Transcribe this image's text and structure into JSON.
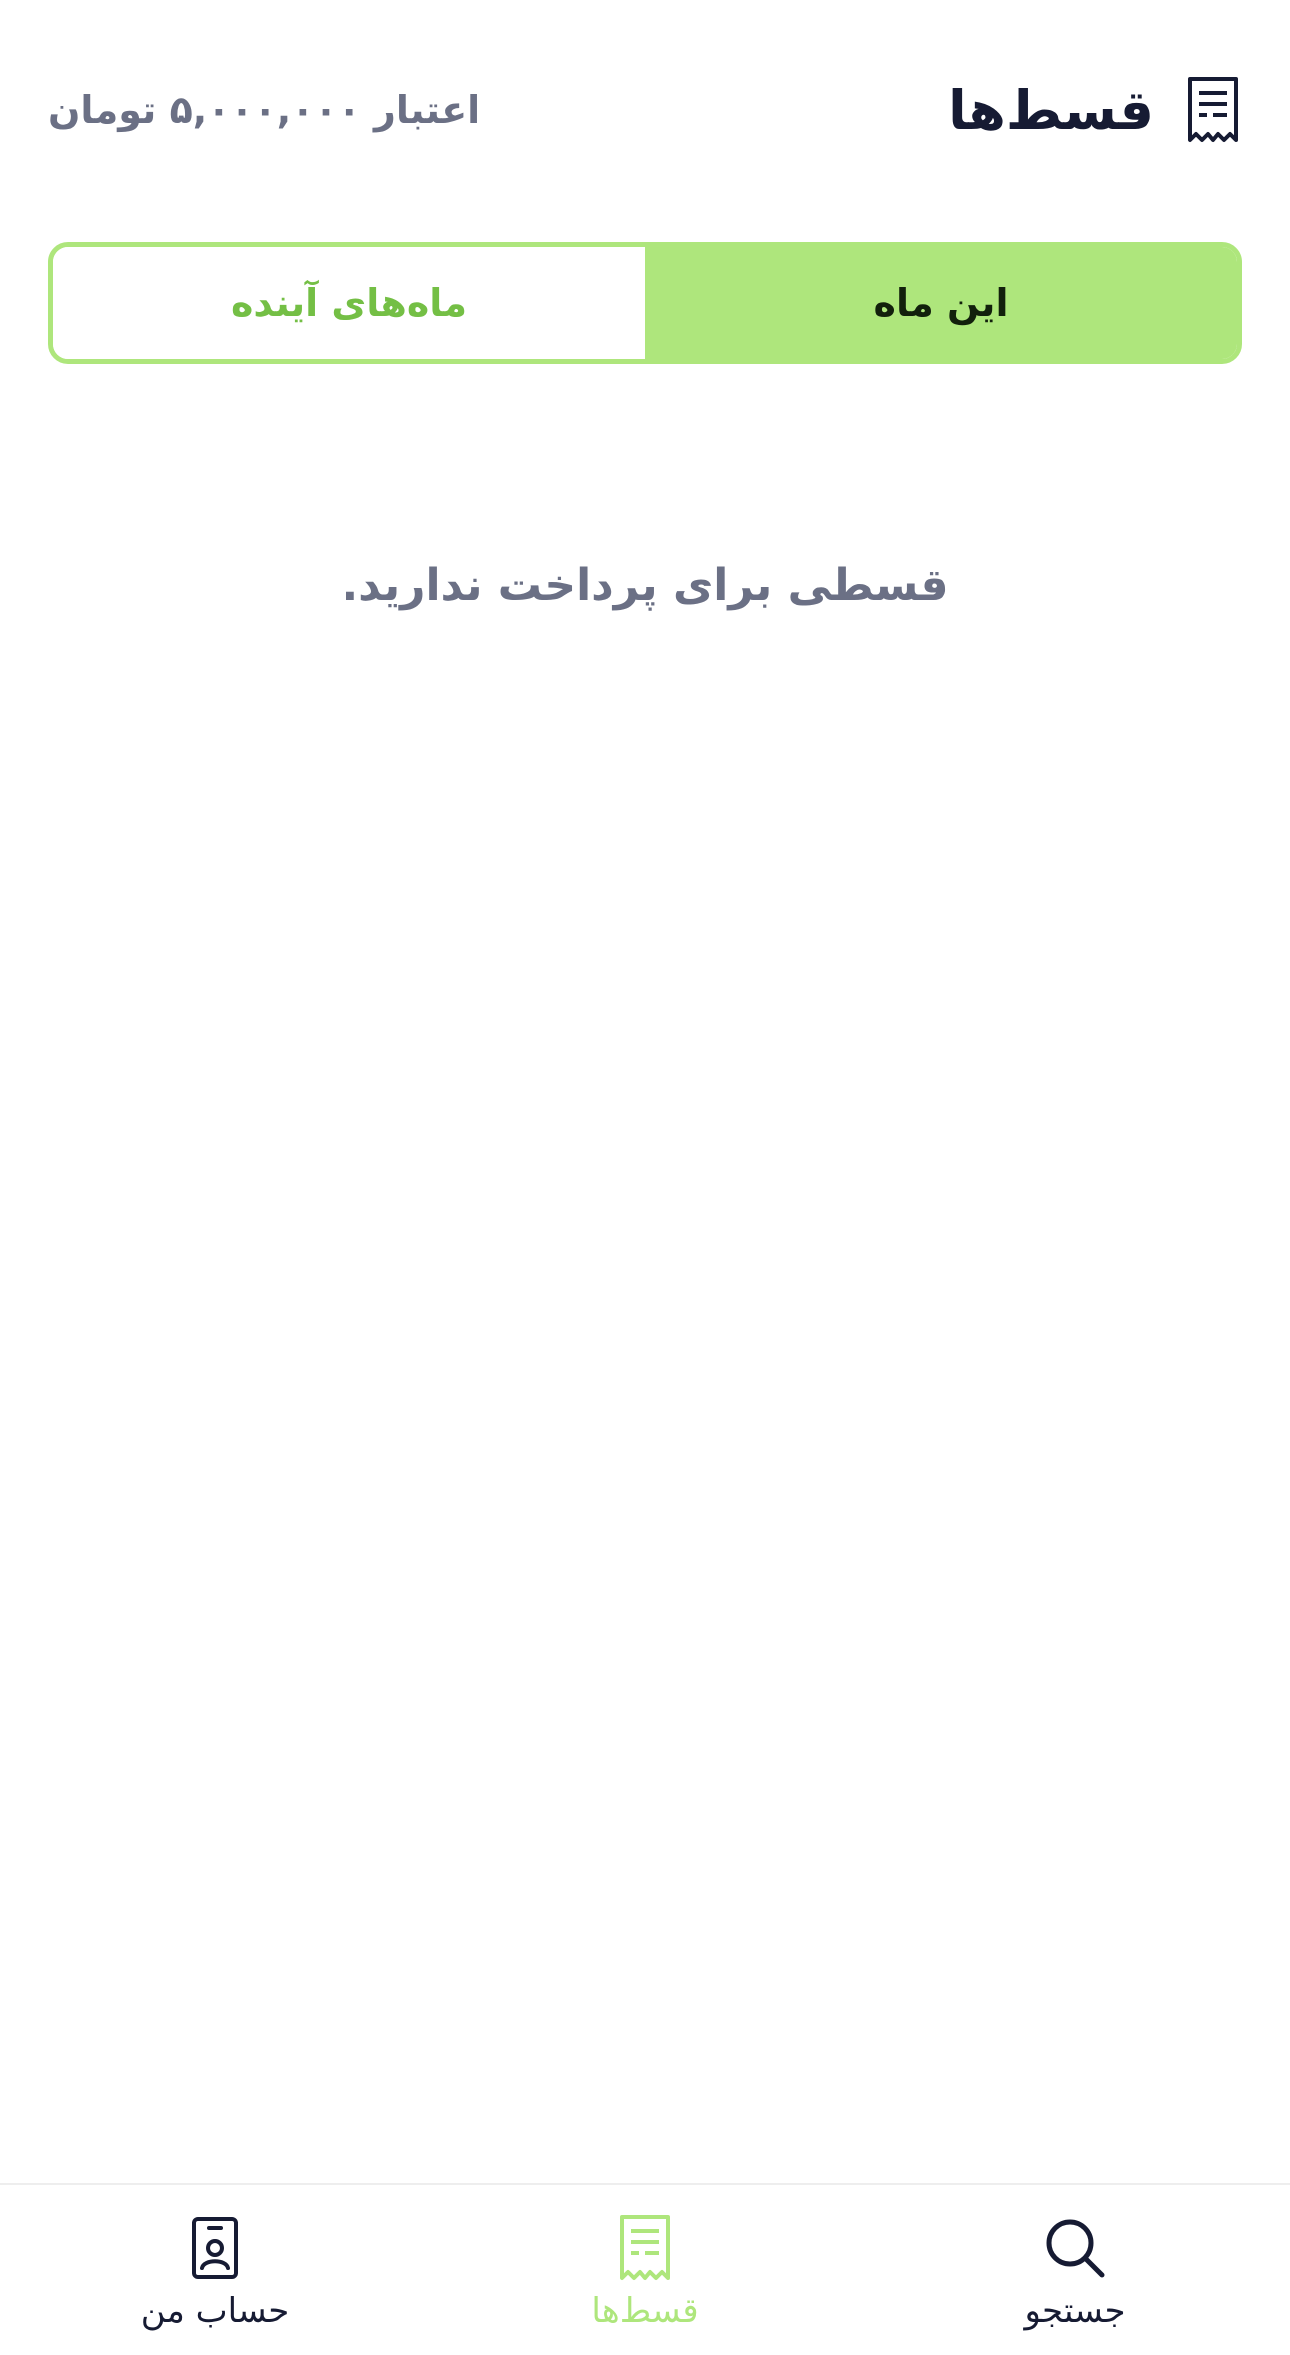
{
  "header": {
    "title": "قسط‌ها",
    "title_icon": "receipt-icon",
    "credit": "اعتبار ۵,۰۰۰,۰۰۰ تومان"
  },
  "tabs": [
    {
      "label": "این ماه",
      "active": true
    },
    {
      "label": "ماه‌های آینده",
      "active": false
    }
  ],
  "empty_state": {
    "message": "قسطی برای پرداخت ندارید."
  },
  "bottom_nav": {
    "items": [
      {
        "label": "حساب من",
        "icon": "id-badge-icon",
        "active": false
      },
      {
        "label": "قسط‌ها",
        "icon": "receipt-icon",
        "active": true
      },
      {
        "label": "جستجو",
        "icon": "search-icon",
        "active": false
      }
    ]
  },
  "colors": {
    "accent": "#aee67c",
    "accent_text": "#74bf45",
    "title": "#161b33",
    "muted": "#6b7085"
  }
}
